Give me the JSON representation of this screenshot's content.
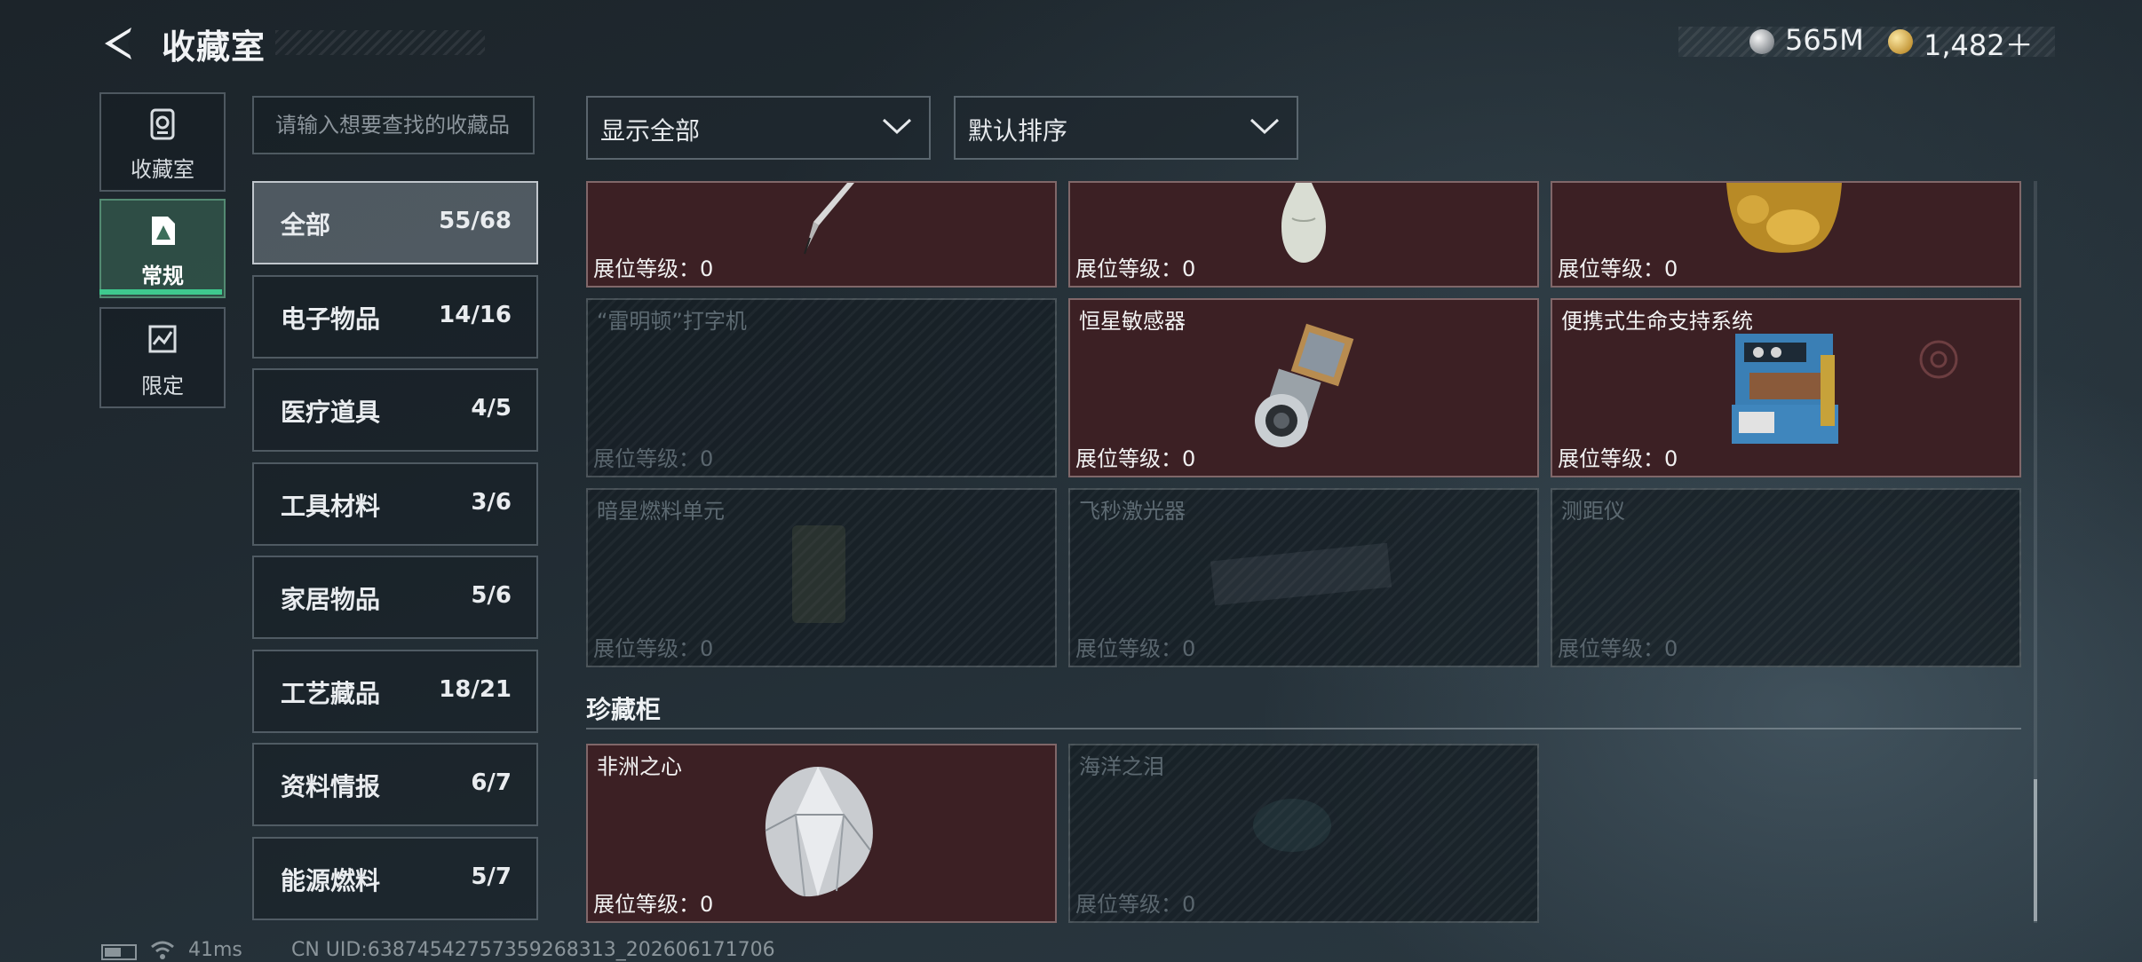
{
  "header": {
    "title": "收藏室",
    "currency": [
      {
        "icon": "silver-coin-icon",
        "value": "565M"
      },
      {
        "icon": "gold-coin-icon",
        "value": "1,482＋"
      }
    ]
  },
  "rail": {
    "items": [
      {
        "label": "收藏室",
        "icon": "collection-icon",
        "active": false
      },
      {
        "label": "常规",
        "icon": "regular-icon",
        "active": true
      },
      {
        "label": "限定",
        "icon": "limited-icon",
        "active": false
      }
    ]
  },
  "search": {
    "placeholder": "请输入想要查找的收藏品",
    "value": ""
  },
  "filters": {
    "show": "显示全部",
    "sort": "默认排序"
  },
  "categories": [
    {
      "name": "全部",
      "count": "55/68",
      "active": true
    },
    {
      "name": "电子物品",
      "count": "14/16"
    },
    {
      "name": "医疗道具",
      "count": "4/5"
    },
    {
      "name": "工具材料",
      "count": "3/6"
    },
    {
      "name": "家居物品",
      "count": "5/6"
    },
    {
      "name": "工艺藏品",
      "count": "18/21"
    },
    {
      "name": "资料情报",
      "count": "6/7"
    },
    {
      "name": "能源燃料",
      "count": "5/7"
    }
  ],
  "grid": {
    "rows": [
      [
        {
          "name": "",
          "level": "展位等级：0",
          "owned": true,
          "art": "pen"
        },
        {
          "name": "",
          "level": "展位等级：0",
          "owned": true,
          "art": "vase"
        },
        {
          "name": "",
          "level": "展位等级：0",
          "owned": true,
          "art": "gold-statue"
        }
      ],
      [
        {
          "name": "“雷明顿”打字机",
          "level": "展位等级：0",
          "owned": false
        },
        {
          "name": "恒星敏感器",
          "level": "展位等级：0",
          "owned": true,
          "art": "star-sensor"
        },
        {
          "name": "便携式生命支持系统",
          "level": "展位等级：0",
          "owned": true,
          "art": "life-support"
        }
      ],
      [
        {
          "name": "暗星燃料单元",
          "level": "展位等级：0",
          "owned": false
        },
        {
          "name": "飞秒激光器",
          "level": "展位等级：0",
          "owned": false
        },
        {
          "name": "测距仪",
          "level": "展位等级：0",
          "owned": false
        }
      ]
    ]
  },
  "shelf": {
    "title": "珍藏柜",
    "items": [
      {
        "name": "非洲之心",
        "level": "展位等级：0",
        "owned": true,
        "art": "diamond"
      },
      {
        "name": "海洋之泪",
        "level": "展位等级：0",
        "owned": false
      }
    ]
  },
  "footer": {
    "ping": "41ms",
    "uid": "CN UID:63874542757359268313_202606171706"
  }
}
